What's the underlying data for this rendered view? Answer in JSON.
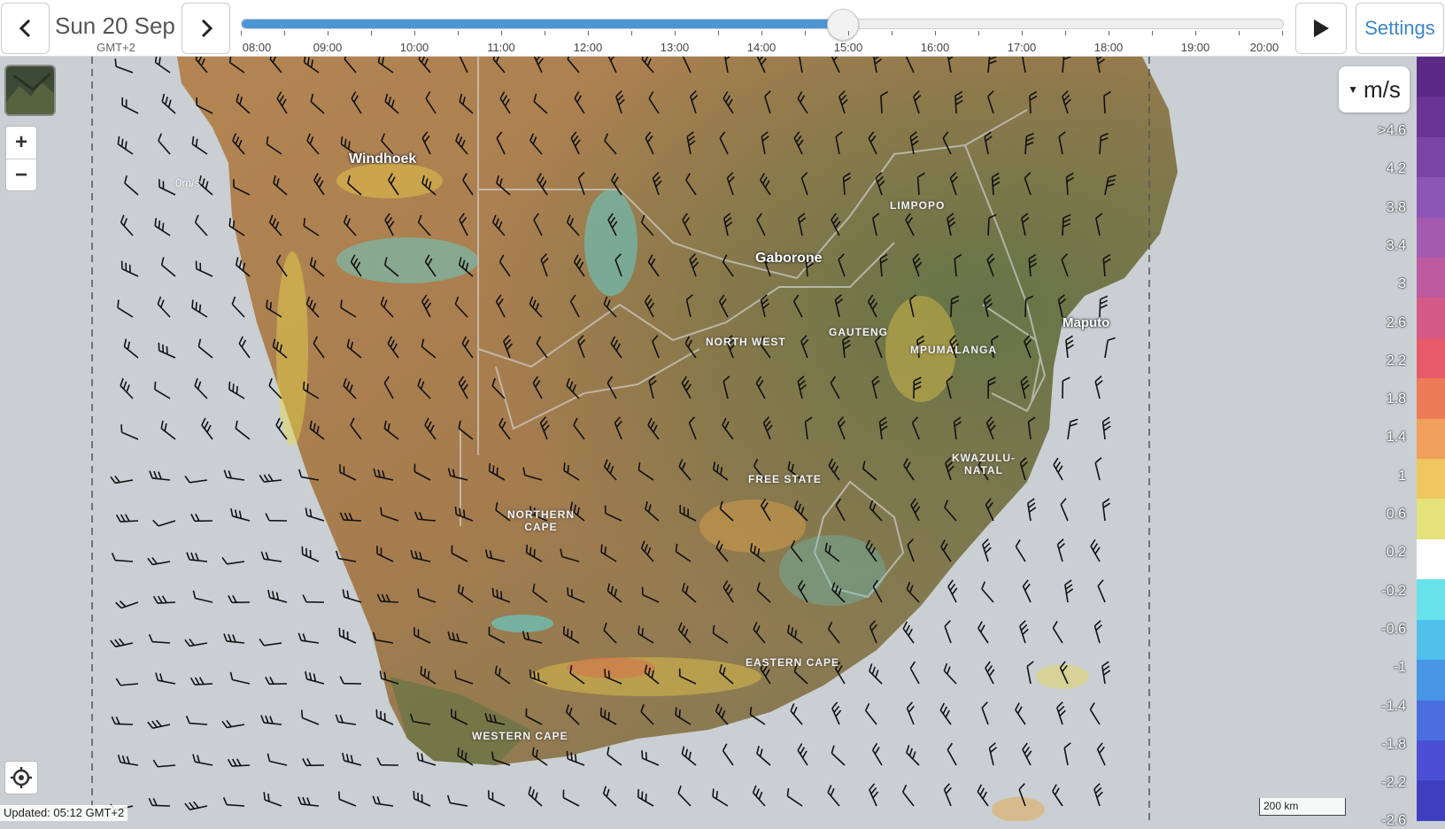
{
  "toolbar": {
    "prev_icon": "chevron-left-icon",
    "next_icon": "chevron-right-icon",
    "date_label": "Sun 20 Sep",
    "timezone": "GMT+2",
    "play_icon": "play-icon",
    "settings_label": "Settings"
  },
  "timeline": {
    "hours": [
      "08:00",
      "09:00",
      "10:00",
      "11:00",
      "12:00",
      "13:00",
      "14:00",
      "15:00",
      "16:00",
      "17:00",
      "18:00",
      "19:00",
      "20:00"
    ],
    "current_time": "15:00",
    "progress_fraction": 0.5759
  },
  "map": {
    "layer_thumbnail": "satellite-layer-icon",
    "zoom_in_label": "+",
    "zoom_out_label": "−",
    "locate_icon": "crosshair-icon",
    "ghost_label": "0m/s",
    "places": [
      {
        "name": "Windhoek"
      },
      {
        "name": "Gaborone"
      },
      {
        "name": "Maputo"
      }
    ],
    "regions": [
      {
        "name": "LIMPOPO"
      },
      {
        "name": "NORTH WEST"
      },
      {
        "name": "GAUTENG"
      },
      {
        "name": "MPUMALANGA"
      },
      {
        "name": "KWAZULU-\nNATAL"
      },
      {
        "name": "FREE STATE"
      },
      {
        "name": "NORTHERN\nCAPE"
      },
      {
        "name": "EASTERN CAPE"
      },
      {
        "name": "WESTERN CAPE"
      }
    ],
    "unit_label": "m/s",
    "updated_text": "Updated: 05:12 GMT+2",
    "scale_label": "200 km"
  },
  "legend": {
    "labels": [
      ">4.6",
      "4.2",
      "3.8",
      "3.4",
      "3",
      "2.6",
      "2.2",
      "1.8",
      "1.4",
      "1",
      "0.6",
      "0.2",
      "-0.2",
      "-0.6",
      "-1",
      "-1.4",
      "-1.8",
      "-2.2",
      "-2.6"
    ],
    "colors": [
      "#5b2a86",
      "#6a3496",
      "#7b44a8",
      "#8d55b5",
      "#a35bb0",
      "#bd5aa0",
      "#d65a86",
      "#e8596a",
      "#ee7b58",
      "#f0a05a",
      "#f0c660",
      "#e6e27a",
      "#ffffff",
      "#66e2e8",
      "#4fc0ec",
      "#4a96e6",
      "#4a6ee0",
      "#4a4fd6",
      "#3f3fc2"
    ]
  }
}
